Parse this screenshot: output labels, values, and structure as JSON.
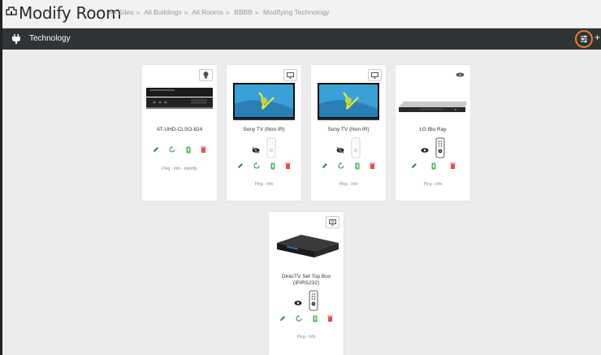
{
  "header": {
    "title": "Modify Room"
  },
  "breadcrumb": [
    "All Sites",
    "All Buildings",
    "All Rooms",
    "BBBB",
    "Modifying Technology"
  ],
  "breadcrumb_sep": "»",
  "section": {
    "title": "Technology",
    "add_label": "+"
  },
  "devices": [
    {
      "name": "AT-UHD-CLSO-824",
      "type_icon": "lightbulb-icon",
      "links": [
        "Ping",
        "Info",
        "Identify"
      ],
      "actions": [
        "edit",
        "sync",
        "bluetooth",
        "delete"
      ]
    },
    {
      "name": "Sony TV (Non IR)",
      "type_icon": "monitor-icon",
      "links": [
        "Ping",
        "Info"
      ],
      "actions": [
        "edit",
        "sync",
        "bluetooth",
        "delete"
      ],
      "visibility": "hidden"
    },
    {
      "name": "Sony TV (Non IR)",
      "type_icon": "monitor-icon",
      "links": [
        "Ping",
        "Info"
      ],
      "actions": [
        "edit",
        "sync",
        "bluetooth",
        "delete"
      ],
      "visibility": "hidden"
    },
    {
      "name": "LG Blu Ray",
      "type_icon": "disc-player-icon",
      "links": [
        "Ping",
        "Info"
      ],
      "actions": [
        "edit",
        "bluetooth",
        "delete"
      ],
      "visibility": "visible"
    },
    {
      "name": "DirecTV Set Top Box (IP/RS232)",
      "type_icon": "settop-box-icon",
      "links": [
        "Ping",
        "Info"
      ],
      "actions": [
        "edit",
        "sync",
        "bluetooth",
        "delete"
      ],
      "visibility": "visible"
    }
  ],
  "link_sep": "-",
  "colors": {
    "accent": "#f07a2a",
    "bar": "#2f3437",
    "edit": "#2e8b57",
    "sync": "#2e8b57",
    "bluetooth": "#4caf50",
    "delete": "#e84d4d"
  }
}
